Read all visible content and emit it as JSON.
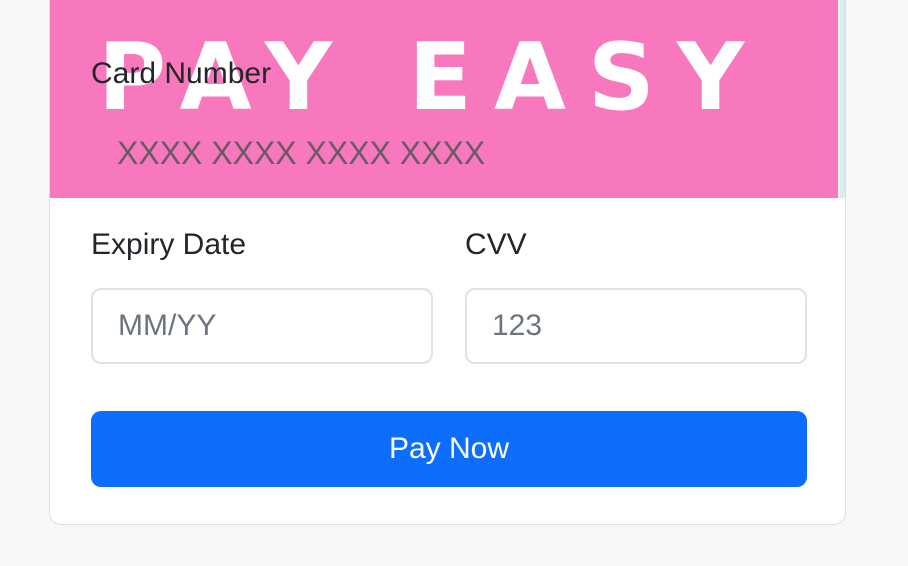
{
  "banner": {
    "brand_text": "PAY EASY",
    "background_color": "#f878bd"
  },
  "card_number": {
    "label": "Card Number",
    "value": "XXXX XXXX XXXX XXXX"
  },
  "expiry": {
    "label": "Expiry Date",
    "placeholder": "MM/YY"
  },
  "cvv": {
    "label": "CVV",
    "placeholder": "123"
  },
  "pay_button": {
    "label": "Pay Now",
    "color": "#0d6efd"
  }
}
